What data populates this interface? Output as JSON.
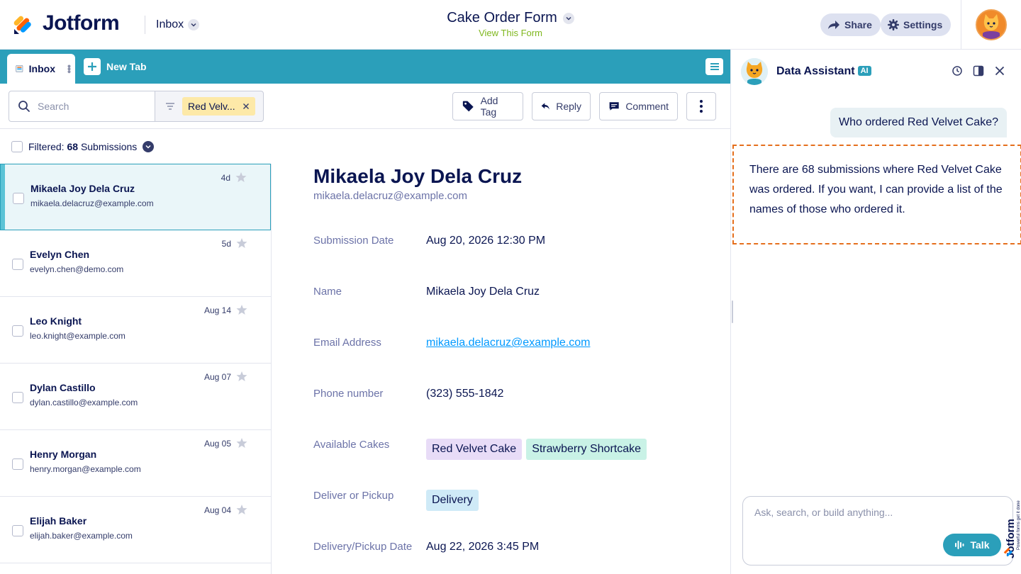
{
  "app": {
    "logo_text": "Jotform",
    "inbox_label": "Inbox"
  },
  "form": {
    "title": "Cake Order Form",
    "subtitle": "View This Form"
  },
  "header": {
    "share_label": "Share",
    "settings_label": "Settings"
  },
  "tabs": {
    "inbox_label": "Inbox",
    "new_tab_label": "New Tab"
  },
  "toolbar": {
    "search_placeholder": "Search",
    "filter_chip": "Red Velv...",
    "add_tag_label": "Add Tag",
    "reply_label": "Reply",
    "comment_label": "Comment"
  },
  "list": {
    "filtered_prefix": "Filtered:",
    "filtered_count": "68",
    "filtered_suffix": "Submissions",
    "items": [
      {
        "name": "Mikaela Joy Dela Cruz",
        "email": "mikaela.delacruz@example.com",
        "date": "4d"
      },
      {
        "name": "Evelyn Chen",
        "email": "evelyn.chen@demo.com",
        "date": "5d"
      },
      {
        "name": "Leo Knight",
        "email": "leo.knight@example.com",
        "date": "Aug 14"
      },
      {
        "name": "Dylan Castillo",
        "email": "dylan.castillo@example.com",
        "date": "Aug 07"
      },
      {
        "name": "Henry Morgan",
        "email": "henry.morgan@example.com",
        "date": "Aug 05"
      },
      {
        "name": "Elijah Baker",
        "email": "elijah.baker@example.com",
        "date": "Aug 04"
      }
    ]
  },
  "detail": {
    "name": "Mikaela Joy Dela Cruz",
    "email": "mikaela.delacruz@example.com",
    "fields": [
      {
        "label": "Submission Date",
        "value": "Aug 20, 2026 12:30 PM"
      },
      {
        "label": "Name",
        "value": "Mikaela Joy Dela Cruz"
      },
      {
        "label": "Email Address",
        "value": "mikaela.delacruz@example.com"
      },
      {
        "label": "Phone number",
        "value": "(323) 555-1842"
      },
      {
        "label": "Available Cakes",
        "tags": [
          "Red Velvet Cake",
          "Strawberry Shortcake"
        ]
      },
      {
        "label": "Deliver or Pickup",
        "tags": [
          "Delivery"
        ]
      },
      {
        "label": "Delivery/Pickup Date",
        "value": "Aug 22, 2026 3:45 PM"
      }
    ]
  },
  "assistant": {
    "title": "Data Assistant",
    "badge": "AI",
    "user_message": "Who ordered Red Velvet Cake?",
    "bot_message": "There are 68 submissions where Red Velvet Cake was ordered. If you want, I can provide a list of the names of those who ordered it.",
    "input_placeholder": "Ask, search, or build anything...",
    "talk_label": "Talk"
  },
  "colors": {
    "brand_navy": "#0a1551",
    "teal": "#2b9fba",
    "highlight_dash": "#e56f1d",
    "tag_purple": "#e8dcf7",
    "tag_mint": "#c9f2e6",
    "tag_blue": "#cfeaf7",
    "filter_yellow": "#fde9a8"
  }
}
